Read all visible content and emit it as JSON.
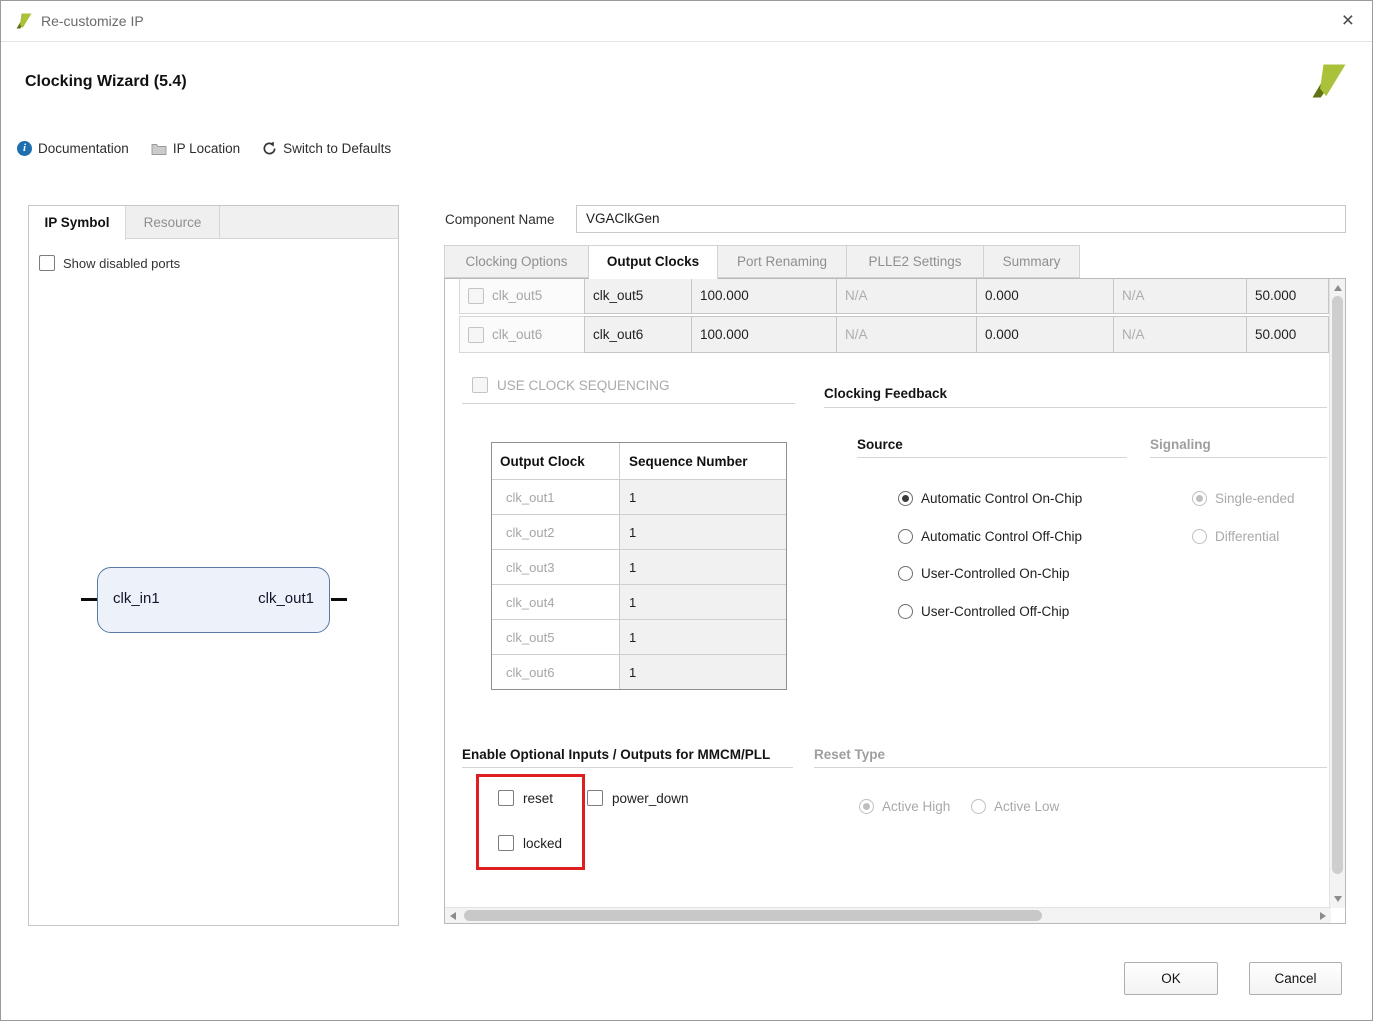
{
  "window": {
    "title": "Re-customize IP",
    "close": "×"
  },
  "header": {
    "title": "Clocking Wizard (5.4)"
  },
  "toolbar": {
    "documentation": "Documentation",
    "ip_location": "IP Location",
    "switch_to_defaults": "Switch to Defaults"
  },
  "left_panel": {
    "tab_ip_symbol": "IP Symbol",
    "tab_resource": "Resource",
    "show_disabled_ports": "Show disabled ports",
    "symbol": {
      "input_port": "clk_in1",
      "output_port": "clk_out1"
    }
  },
  "component": {
    "label": "Component Name",
    "value": "VGAClkGen"
  },
  "tabs": {
    "clocking_options": "Clocking Options",
    "output_clocks": "Output Clocks",
    "port_renaming": "Port Renaming",
    "plle2_settings": "PLLE2 Settings",
    "summary": "Summary"
  },
  "clock_rows": [
    {
      "port": "clk_out5",
      "name": "clk_out5",
      "freq": "100.000",
      "freq_actual": "N/A",
      "phase": "0.000",
      "phase_actual": "N/A",
      "duty": "50.000"
    },
    {
      "port": "clk_out6",
      "name": "clk_out6",
      "freq": "100.000",
      "freq_actual": "N/A",
      "phase": "0.000",
      "phase_actual": "N/A",
      "duty": "50.000"
    }
  ],
  "sequencing": {
    "checkbox_label": "USE CLOCK SEQUENCING",
    "table": {
      "col_clock": "Output Clock",
      "col_seq": "Sequence Number",
      "rows": [
        {
          "clock": "clk_out1",
          "seq": "1"
        },
        {
          "clock": "clk_out2",
          "seq": "1"
        },
        {
          "clock": "clk_out3",
          "seq": "1"
        },
        {
          "clock": "clk_out4",
          "seq": "1"
        },
        {
          "clock": "clk_out5",
          "seq": "1"
        },
        {
          "clock": "clk_out6",
          "seq": "1"
        }
      ]
    }
  },
  "clocking_feedback": {
    "title": "Clocking Feedback",
    "source_label": "Source",
    "signaling_label": "Signaling",
    "source_options": [
      {
        "label": "Automatic Control On-Chip",
        "selected": true
      },
      {
        "label": "Automatic Control Off-Chip",
        "selected": false
      },
      {
        "label": "User-Controlled On-Chip",
        "selected": false
      },
      {
        "label": "User-Controlled Off-Chip",
        "selected": false
      }
    ],
    "signaling_options": [
      {
        "label": "Single-ended",
        "selected": true
      },
      {
        "label": "Differential",
        "selected": false
      }
    ]
  },
  "optional_io": {
    "title": "Enable Optional Inputs / Outputs for MMCM/PLL",
    "reset": "reset",
    "power_down": "power_down",
    "locked": "locked"
  },
  "reset_type": {
    "title": "Reset Type",
    "active_high": "Active High",
    "active_low": "Active Low"
  },
  "footer": {
    "ok": "OK",
    "cancel": "Cancel"
  },
  "colors": {
    "highlight_red": "#dd1f1f",
    "brand_green": "#a9c23a"
  }
}
